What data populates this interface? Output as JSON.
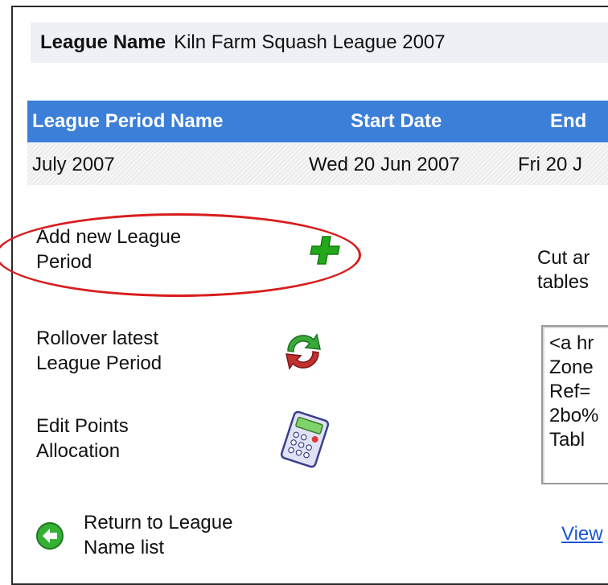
{
  "league": {
    "name_label": "League Name",
    "name_value": "Kiln Farm Squash League 2007"
  },
  "table": {
    "headers": [
      "League Period Name",
      "Start Date",
      "End"
    ],
    "rows": [
      [
        "July 2007",
        "Wed 20 Jun 2007",
        "Fri 20 J"
      ]
    ]
  },
  "actions": {
    "add": {
      "line1": "Add new League",
      "line2": "Period",
      "icon": "plus-icon"
    },
    "rollover": {
      "line1": "Rollover latest",
      "line2": "League Period",
      "icon": "refresh-arrows-icon"
    },
    "points": {
      "line1": "Edit Points",
      "line2": "Allocation",
      "icon": "calculator-icon"
    },
    "return": {
      "line1": "Return to League",
      "line2": "Name list",
      "icon": "back-arrow-icon"
    }
  },
  "embed": {
    "instruction_line1": "Cut ar",
    "instruction_line2": "tables",
    "code_lines": [
      "<a hr",
      "Zone",
      "Ref=",
      "2bo%",
      "Tabl"
    ],
    "view_link": "View"
  },
  "colors": {
    "header_bg": "#3b7fd8",
    "name_box_bg": "#eef0f6",
    "highlight_ellipse": "#d91c1c",
    "link": "#1a55d4"
  }
}
